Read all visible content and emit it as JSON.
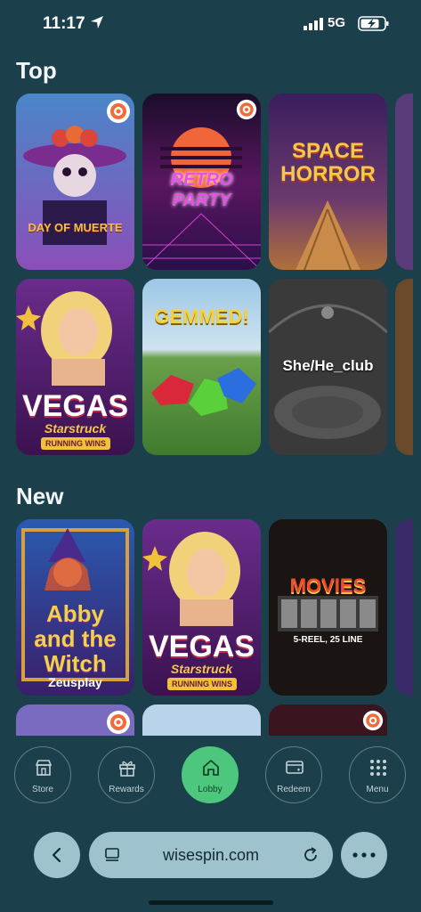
{
  "status": {
    "time": "11:17",
    "network": "5G"
  },
  "sections": [
    {
      "title": "Top"
    },
    {
      "title": "New"
    }
  ],
  "games": {
    "top_row1": [
      {
        "name": "DAY OF MUERTE",
        "icon": "target-badge-icon"
      },
      {
        "name": "RETRO PARTY",
        "icon": "target-badge-icon"
      },
      {
        "name": "SPACE HORROR"
      }
    ],
    "top_row2": [
      {
        "name": "VEGAS",
        "sub": "Starstruck",
        "tag": "RUNNING WINS"
      },
      {
        "name": "GEMMED!"
      },
      {
        "name": "She/He_club"
      }
    ],
    "new_row1": [
      {
        "name": "Abby and the Witch",
        "provider": "Zeusplay"
      },
      {
        "name": "VEGAS",
        "sub": "Starstruck",
        "tag": "RUNNING WINS"
      },
      {
        "name": "MOVIES",
        "sub": "5-REEL, 25 LINE"
      }
    ]
  },
  "tabs": [
    {
      "label": "Store",
      "icon": "store-icon"
    },
    {
      "label": "Rewards",
      "icon": "gift-icon"
    },
    {
      "label": "Lobby",
      "icon": "home-icon",
      "active": true
    },
    {
      "label": "Redeem",
      "icon": "card-icon"
    },
    {
      "label": "Menu",
      "icon": "grid-icon"
    }
  ],
  "browser": {
    "url": "wisespin.com"
  },
  "colors": {
    "background": "#1c3f4c",
    "accent": "#4cc77d",
    "browser_bar": "#9fc2cf"
  }
}
